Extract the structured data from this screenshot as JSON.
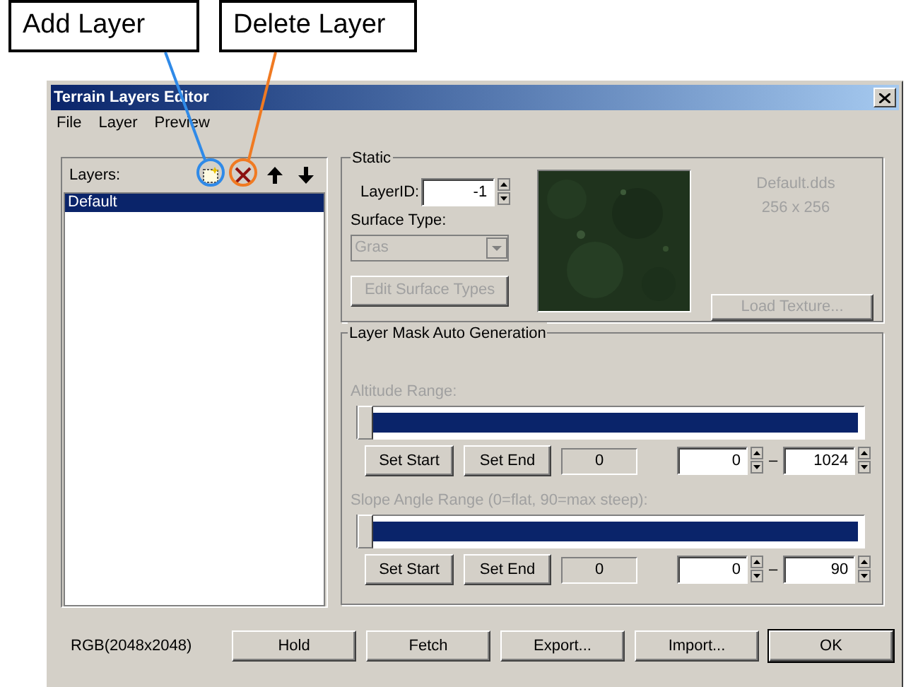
{
  "callouts": [
    {
      "label": "Add Layer",
      "color": "#2f8ae8"
    },
    {
      "label": "Delete Layer",
      "color": "#f07a22"
    }
  ],
  "window": {
    "title": "Terrain Layers Editor"
  },
  "menu": [
    {
      "label": "File"
    },
    {
      "label": "Layer"
    },
    {
      "label": "Preview"
    }
  ],
  "layers_panel": {
    "label": "Layers:",
    "items": [
      {
        "label": "Default",
        "selected": true
      }
    ]
  },
  "static": {
    "title": "Static",
    "layer_id_label": "LayerID:",
    "layer_id": "-1",
    "surface_type_label": "Surface Type:",
    "surface_type": "Gras",
    "surface_type_disabled": true,
    "edit_button": {
      "label": "Edit Surface Types",
      "disabled": true
    },
    "texture_name": "Default.dds",
    "texture_size": "256 x 256",
    "load_button": {
      "label": "Load Texture...",
      "disabled": true
    }
  },
  "mask": {
    "title": "Layer Mask Auto Generation",
    "ranges": [
      {
        "label": "Altitude Range:",
        "disabled": true,
        "level": 0,
        "set_start": "Set Start",
        "set_end": "Set End",
        "reading": "0",
        "from": "0",
        "dash": "–",
        "to": "1024"
      },
      {
        "label": "Slope Angle Range (0=flat, 90=max steep):",
        "disabled": true,
        "level": 0,
        "set_start": "Set Start",
        "set_end": "Set End",
        "reading": "0",
        "from": "0",
        "dash": "–",
        "to": "90"
      }
    ]
  },
  "status": "RGB(2048x2048)",
  "buttons": [
    {
      "label": "Hold",
      "default": false
    },
    {
      "label": "Fetch",
      "default": false
    },
    {
      "label": "Export...",
      "default": false
    },
    {
      "label": "Import...",
      "default": false
    },
    {
      "label": "OK",
      "default": true
    }
  ]
}
